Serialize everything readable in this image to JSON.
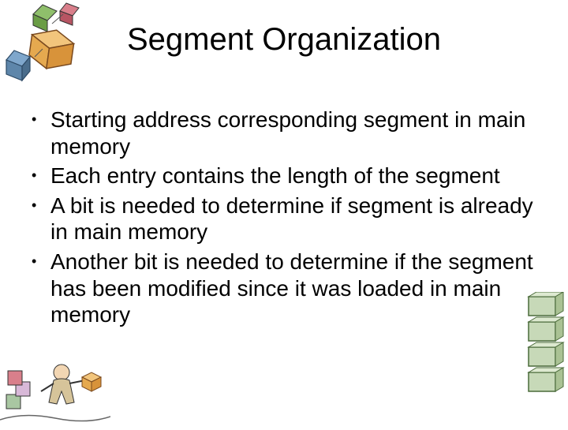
{
  "title": "Segment Organization",
  "bullets": [
    "Starting address corresponding segment in main memory",
    "Each entry contains the length of the segment",
    "A bit is needed to determine if segment is already in main memory",
    "Another bit is needed to determine if the segment has been modified since it was loaded in main memory"
  ]
}
